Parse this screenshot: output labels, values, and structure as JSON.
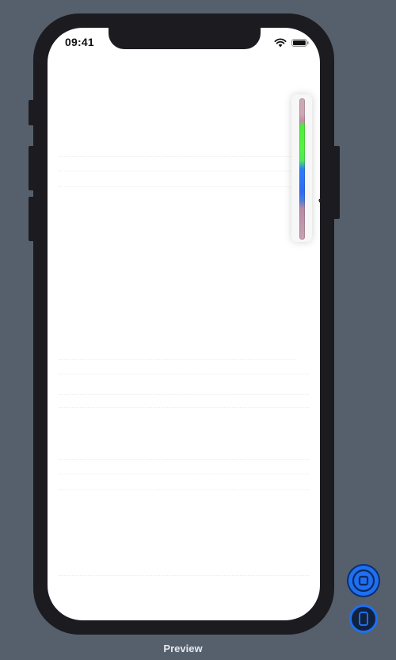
{
  "status_bar": {
    "time": "09:41",
    "wifi_icon": "wifi-icon",
    "battery_icon": "battery-icon"
  },
  "color_slider": {
    "colors": [
      "#c9a9b4",
      "#4dee3a",
      "#2f6bf6",
      "#c9a1b1"
    ],
    "cursor_icon": "pointing-hand-cursor-icon"
  },
  "canvas_controls": {
    "live_preview_icon": "live-preview-icon",
    "device_icon": "device-icon",
    "preview_label": "Preview"
  },
  "colors": {
    "canvas_background": "#56606d",
    "device_frame": "#1c1b20",
    "accent": "#1f6ff0"
  }
}
